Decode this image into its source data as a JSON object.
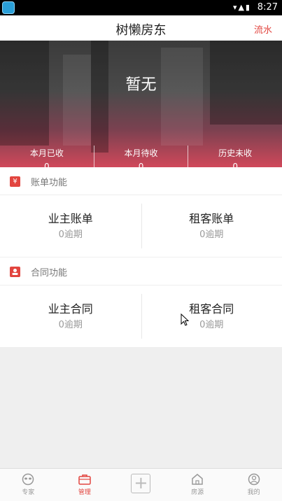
{
  "status_bar": {
    "time": "8:27"
  },
  "header": {
    "title": "树懒房东",
    "flow_link": "流水"
  },
  "banner": {
    "amount": "暂无",
    "stats": [
      {
        "label": "本月已收",
        "value": "0"
      },
      {
        "label": "本月待收",
        "value": "0"
      },
      {
        "label": "历史未收",
        "value": "0"
      }
    ]
  },
  "bills": {
    "icon_text": "¥",
    "title": "账单功能",
    "items": [
      {
        "name": "业主账单",
        "sub": "0逾期"
      },
      {
        "name": "租客账单",
        "sub": "0逾期"
      }
    ]
  },
  "contracts": {
    "title": "合同功能",
    "items": [
      {
        "name": "业主合同",
        "sub": "0逾期"
      },
      {
        "name": "租客合同",
        "sub": "0逾期"
      }
    ]
  },
  "tab_bar": {
    "accent": "#e2453f",
    "tabs": [
      {
        "label": "专家",
        "icon": "sloth-face-icon"
      },
      {
        "label": "管理",
        "icon": "briefcase-icon",
        "active": true
      },
      {
        "label": "",
        "icon": "plus-icon"
      },
      {
        "label": "房源",
        "icon": "house-icon"
      },
      {
        "label": "我的",
        "icon": "user-icon"
      }
    ]
  }
}
